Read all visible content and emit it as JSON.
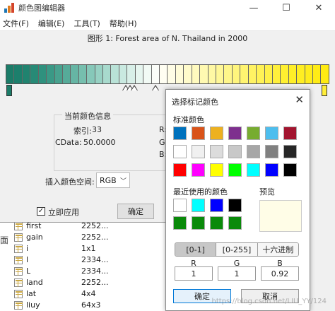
{
  "window": {
    "title": "颜色图编辑器",
    "controls": [
      "—",
      "☐",
      "✕"
    ]
  },
  "menu": [
    "文件(F)",
    "编辑(E)",
    "工具(T)",
    "帮助(H)"
  ],
  "figure_title": "图形 1: Forest area of N. Thailand in 2000",
  "colormap": {
    "colors": [
      "#1b7c68",
      "#1c7f6c",
      "#20836f",
      "#278a76",
      "#2f917e",
      "#3a9986",
      "#48a28f",
      "#56ab99",
      "#66b5a4",
      "#76bfae",
      "#86c8b9",
      "#97d1c3",
      "#a8dacd",
      "#b9e2d7",
      "#c9e9e0",
      "#d8efe8",
      "#e6f5ef",
      "#f2faf5",
      "#fbfdf9",
      "#fffef2",
      "#fffde6",
      "#fffcd8",
      "#fffbcb",
      "#fffabe",
      "#fff9b1",
      "#fff8a4",
      "#fff797",
      "#fff68a",
      "#fff57d",
      "#fff470",
      "#fff363",
      "#fff256",
      "#fff149",
      "#fff03c",
      "#fff030",
      "#ffef28",
      "#ffee22",
      "#ffed1c",
      "#ffec16",
      "#ffeb12"
    ],
    "marker_left_color": "#1b7c68",
    "marker_right_color": "#ffee3a"
  },
  "current_info": {
    "group_label": "当前颜色信息",
    "index_label": "索引:",
    "index_value": "33",
    "cdata_label": "CData:",
    "cdata_value": "50.0000",
    "r_partial": "R:",
    "g_partial": "G:",
    "b_partial": "B:"
  },
  "color_space": {
    "label": "插入颜色空间:",
    "value": "RGB"
  },
  "apply": {
    "label": "立即应用",
    "checked": "✓"
  },
  "ok_button": "确定",
  "bracket": "面",
  "workspace": [
    {
      "name": "first",
      "value": "2252..."
    },
    {
      "name": "gain",
      "value": "2252..."
    },
    {
      "name": "i",
      "value": "1x1"
    },
    {
      "name": "l",
      "value": "2334..."
    },
    {
      "name": "L",
      "value": "2334..."
    },
    {
      "name": "land",
      "value": "2252..."
    },
    {
      "name": "lat",
      "value": "4x4"
    },
    {
      "name": "liuy",
      "value": "64x3"
    }
  ],
  "dialog": {
    "title": "选择标记颜色",
    "close": "✕",
    "standard_label": "标准颜色",
    "standard_colors": [
      "#0072bd",
      "#d95319",
      "#edb120",
      "#7e2f8e",
      "#77ac30",
      "#4dbeee",
      "#a2142f",
      "#ffffff",
      "#f0f0f0",
      "#dcdcdc",
      "#c8c8c8",
      "#a6a6a6",
      "#808080",
      "#262626",
      "#ff0000",
      "#ff00ff",
      "#ffff00",
      "#00ff00",
      "#00ffff",
      "#0000ff",
      "#000000"
    ],
    "recent_label": "最近使用的颜色",
    "recent_colors": [
      "#ffffff",
      "#00ffff",
      "#0000ff",
      "#000000",
      "#0a8a0a",
      "#0a8a0a",
      "#0a8a0a",
      "#0a8a0a"
    ],
    "preview_label": "预览",
    "preview_color": "#fffde7",
    "tabs": [
      "[0-1]",
      "[0-255]",
      "十六进制"
    ],
    "active_tab": "[0-1]",
    "r_label": "R",
    "g_label": "G",
    "b_label": "B",
    "r_value": "1",
    "g_value": "1",
    "b_value": "0.92",
    "ok": "确定",
    "cancel": "取消"
  },
  "watermark": "https://blog.csdn.net/LIU_YY/124"
}
